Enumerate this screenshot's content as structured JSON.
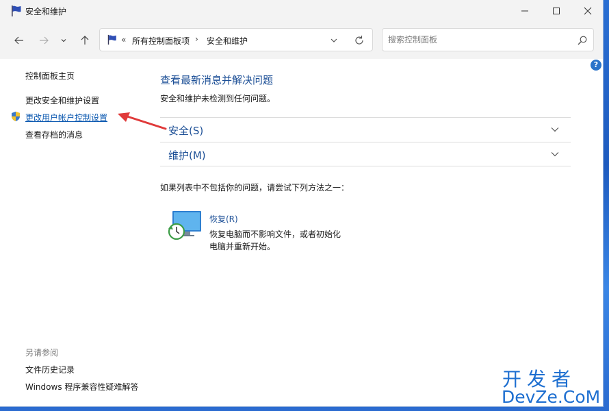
{
  "window": {
    "title": "安全和维护"
  },
  "address_bar": {
    "overflow": "«",
    "crumbs": [
      "所有控制面板项",
      "安全和维护"
    ],
    "separator": "›"
  },
  "search": {
    "placeholder": "搜索控制面板"
  },
  "help": {
    "label": "?"
  },
  "left_panel": {
    "home": "控制面板主页",
    "change_security": "更改安全和维护设置",
    "change_uac": "更改用户帐户控制设置",
    "archived": "查看存档的消息",
    "see_also": "另请参阅",
    "file_history": "文件历史记录",
    "compat": "Windows 程序兼容性疑难解答"
  },
  "main": {
    "title": "查看最新消息并解决问题",
    "subtitle": "安全和维护未检测到任何问题。",
    "sections": [
      {
        "label": "安全(S)"
      },
      {
        "label": "维护(M)"
      }
    ],
    "hint": "如果列表中不包括你的问题，请尝试下列方法之一：",
    "recovery": {
      "link": "恢复(R)",
      "description": "恢复电脑而不影响文件，或者初始化电脑并重新开始。"
    }
  },
  "watermark": {
    "line1": "开发者",
    "line2": "DevZe.CoM"
  },
  "colors": {
    "link": "#1c4f96",
    "accent": "#0b58b0",
    "arrow": "#e03a3a"
  }
}
